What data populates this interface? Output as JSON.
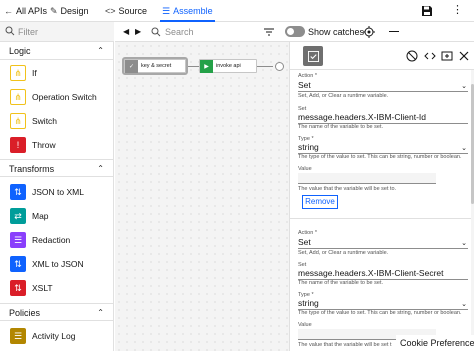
{
  "tabs": [
    {
      "label": "All APIs",
      "icon": "back-arrow-icon"
    },
    {
      "label": "Design",
      "icon": "design-icon"
    },
    {
      "label": "Source",
      "icon": "code-icon"
    },
    {
      "label": "Assemble",
      "icon": "assemble-icon",
      "active": true
    }
  ],
  "palette": {
    "filter_placeholder": "Filter",
    "sections": [
      {
        "title": "Logic",
        "items": [
          {
            "label": "If",
            "icon": "if-icon",
            "color": "#f1c21b"
          },
          {
            "label": "Operation Switch",
            "icon": "operation-switch-icon",
            "color": "#f1c21b"
          },
          {
            "label": "Switch",
            "icon": "switch-icon",
            "color": "#f1c21b"
          },
          {
            "label": "Throw",
            "icon": "warning-icon",
            "color": "#da1e28"
          }
        ]
      },
      {
        "title": "Transforms",
        "items": [
          {
            "label": "JSON to XML",
            "icon": "json-to-xml-icon",
            "color": "#0f62fe"
          },
          {
            "label": "Map",
            "icon": "map-icon",
            "color": "#009d9a"
          },
          {
            "label": "Redaction",
            "icon": "redaction-icon",
            "color": "#8a3ffc"
          },
          {
            "label": "XML to JSON",
            "icon": "xml-to-json-icon",
            "color": "#0f62fe"
          },
          {
            "label": "XSLT",
            "icon": "xslt-icon",
            "color": "#da1e28"
          }
        ]
      },
      {
        "title": "Policies",
        "items": [
          {
            "label": "Activity Log",
            "icon": "activity-log-icon",
            "color": "#b28600"
          }
        ]
      }
    ]
  },
  "canvas_toolbar": {
    "search_placeholder": "Search",
    "show_catches_label": "Show catches"
  },
  "flow": {
    "nodes": [
      {
        "label": "key & secret",
        "icon": "set-variable-icon",
        "color": "#8d8d8d"
      },
      {
        "label": "invoke api",
        "icon": "play-icon",
        "color": "#24a148"
      }
    ]
  },
  "panel": {
    "actions": [
      {
        "action_label": "Action *",
        "action_value": "Set",
        "action_help": "Set, Add, or Clear a runtime variable.",
        "set_label": "Set",
        "set_value": "message.headers.X-IBM-Client-Id",
        "set_help": "The name of the variable to be set.",
        "type_label": "Type *",
        "type_value": "string",
        "type_help": "The type of the value to set. This can be string, number or boolean.",
        "value_label": "Value",
        "value_help": "The value that the variable will be set to.",
        "remove_label": "Remove"
      },
      {
        "action_label": "Action *",
        "action_value": "Set",
        "action_help": "Set, Add, or Clear a runtime variable.",
        "set_label": "Set",
        "set_value": "message.headers.X-IBM-Client-Secret",
        "set_help": "The name of the variable to be set.",
        "type_label": "Type *",
        "type_value": "string",
        "type_help": "The type of the value to set. This can be string, number or boolean.",
        "value_label": "Value",
        "value_help": "The value that the variable will be set t"
      }
    ]
  },
  "cookie_label": "Cookie Preferences",
  "colors": {
    "accent": "#0f62fe",
    "canvas_bg": "#f4f4f4",
    "border": "#e0e0e0"
  }
}
